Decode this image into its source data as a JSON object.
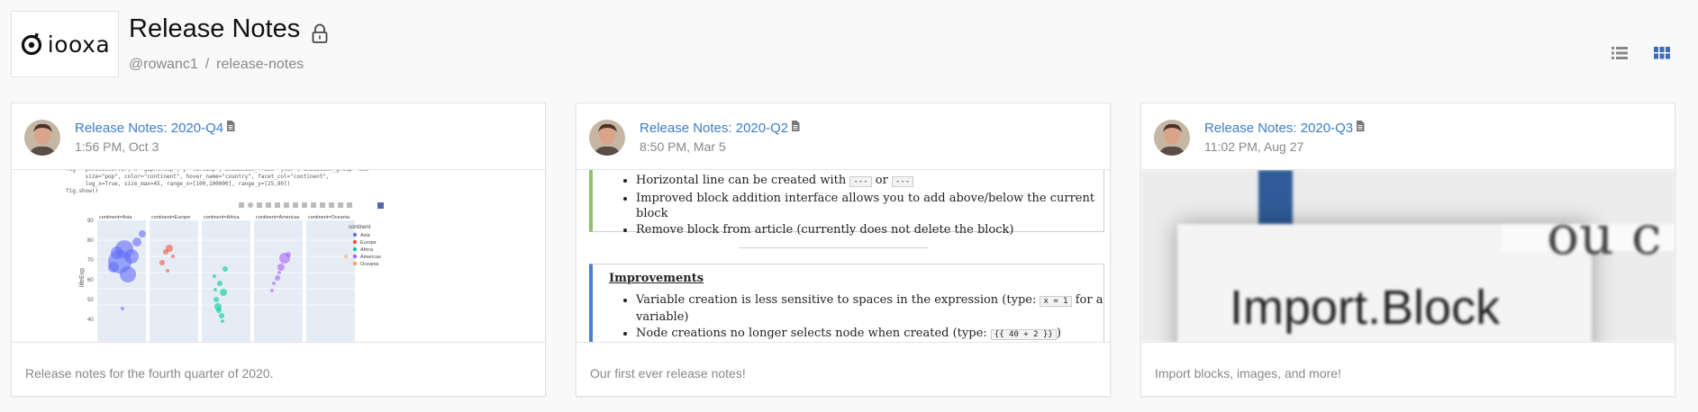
{
  "header": {
    "logo_text": "iooxa",
    "title": "Release Notes",
    "breadcrumb_user": "@rowanc1",
    "breadcrumb_sep": "/",
    "breadcrumb_repo": "release-notes"
  },
  "view_toggle": {
    "list_icon": "list-view-icon",
    "grid_icon": "grid-view-icon",
    "active": "grid",
    "active_color": "#3d6db5",
    "inactive_color": "#888888"
  },
  "cards": [
    {
      "title": "Release Notes: 2020-Q4",
      "time": "1:56 PM, Oct 3",
      "description": "Release notes for the fourth quarter of 2020.",
      "preview": {
        "code": "fig = px.scatter(df, x=\"gdpPercap\", y=\"lifeExp\", animation_frame=\"year\", animation_group=\"cou\n      size=\"pop\", color=\"continent\", hover_name=\"country\", facet_col=\"continent\",\n      log_x=True, size_max=45, range_x=[100,100000], range_y=[25,90])\nfig.show()",
        "facets": [
          "continent=Asia",
          "continent=Europe",
          "continent=Africa",
          "continent=Americas",
          "continent=Oceania"
        ],
        "legend_title": "continent",
        "legend": [
          "Asia",
          "Europe",
          "Africa",
          "Americas",
          "Oceania"
        ],
        "y_label": "lifeExp",
        "y_ticks": [
          "90",
          "80",
          "70",
          "60",
          "50",
          "40"
        ]
      }
    },
    {
      "title": "Release Notes: 2020-Q2",
      "time": "8:50 PM, Mar 5",
      "description": "Our first ever release notes!",
      "preview": {
        "items_a": [
          {
            "pre": "Horizontal line can be created with ",
            "code1": "---",
            "mid": " or ",
            "code2": "---"
          },
          {
            "text": "Improved block addition interface allows you to add above/below the current block"
          },
          {
            "text": "Remove block from article (currently does not delete the block)"
          }
        ],
        "improvements_title": "Improvements",
        "items_b": [
          {
            "pre": "Variable creation is less sensitive to spaces in the expression (type: ",
            "code": "x = 1",
            "post": " for a variable)"
          },
          {
            "pre": "Node creations no longer selects node when created (type: ",
            "code": "{{ 40 + 2 }}",
            "post": ")"
          }
        ]
      }
    },
    {
      "title": "Release Notes: 2020-Q3",
      "time": "11:02 PM, Aug 27",
      "description": "Import blocks, images, and more!",
      "preview": {
        "big_text": "Import.Block",
        "side_text": "ou c"
      }
    }
  ]
}
